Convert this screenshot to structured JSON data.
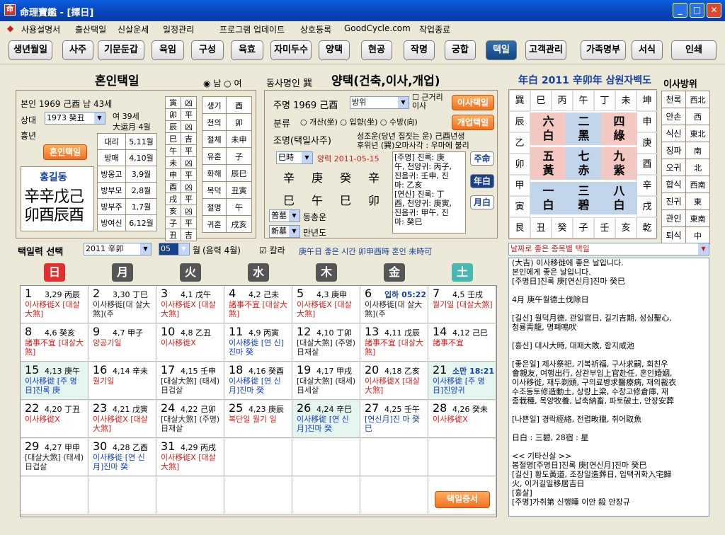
{
  "window": {
    "title": "命理寶鑑 - [擇日]"
  },
  "menu": [
    "사용설명서",
    "출산택일",
    "신살운세",
    "일정관리",
    "프로그램 업데이트",
    "상호등록",
    "GoodCycle.com",
    "작업종료"
  ],
  "toolbar": [
    "생년월일",
    "사주",
    "기문둔갑",
    "육임",
    "구성",
    "육효",
    "자미두수",
    "양택",
    "현공",
    "작명",
    "궁합",
    "택일",
    "고객관리",
    "가족명부",
    "서식",
    "인쇄"
  ],
  "toolbar_active": "택일",
  "marriage": {
    "title": "혼인택일",
    "gender_male": "남",
    "gender_female": "여",
    "self_label": "본인",
    "self_info": "1969 己酉 남 43세",
    "partner_label": "상대",
    "partner_year": "1973 癸丑",
    "partner_info1": "여 39세",
    "partner_info2": "大运月 4월",
    "heunnyeon": "흉년",
    "btn": "혼인택일",
    "name": "홍길동",
    "saju_top": "辛辛戊己",
    "saju_bottom": "卯酉辰酉",
    "dae_rows": [
      [
        "대리",
        "5,11월"
      ],
      [
        "방매",
        "4,10월"
      ],
      [
        "방옹고",
        "3,9월"
      ],
      [
        "방부모",
        "2,8월"
      ],
      [
        "방부주",
        "1,7월"
      ],
      [
        "방여신",
        "6,12월"
      ]
    ],
    "branch_rows": [
      [
        "寅",
        "凶"
      ],
      [
        "卯",
        "平"
      ],
      [
        "辰",
        "凶"
      ],
      [
        "巳",
        "吉"
      ],
      [
        "午",
        "平"
      ],
      [
        "未",
        "凶"
      ],
      [
        "申",
        "平"
      ],
      [
        "酉",
        "凶"
      ],
      [
        "戌",
        "平"
      ],
      [
        "亥",
        "凶"
      ],
      [
        "子",
        "平"
      ],
      [
        "丑",
        "吉"
      ]
    ],
    "god_rows": [
      [
        "생기",
        "酉"
      ],
      [
        "천의",
        "卯"
      ],
      [
        "절체",
        "未申"
      ],
      [
        "유혼",
        "子"
      ],
      [
        "화해",
        "辰巳"
      ],
      [
        "복덕",
        "丑寅"
      ],
      [
        "절명",
        "午"
      ],
      [
        "귀혼",
        "戌亥"
      ]
    ]
  },
  "yangtaek": {
    "top_label": "동사명인",
    "top_dir": "巽",
    "title": "양택(건축,이사,개업)",
    "owner_label": "주명",
    "owner_info": "1969 己酉",
    "dir_select": "방위",
    "check_label": "근거리 이사",
    "btn_move": "이사택일",
    "btn_open": "개업택일",
    "cat_label": "분류",
    "opts": [
      "개산(坐)",
      "입향(坐)",
      "수방(向)"
    ],
    "zm_label": "조명(택일사주)",
    "zm_note1": "성조운(당년 집짓는 운) 己酉년생",
    "zm_note2": "후위년 (巽)오마사각 : 우마에 불리",
    "hour_select": "巳時",
    "solar_date": "양력 2011-05-15",
    "saju_top": [
      "辛",
      "庚",
      "癸",
      "辛"
    ],
    "saju_bottom": [
      "巳",
      "午",
      "巳",
      "卯"
    ],
    "info_text": [
      "[주명] 진록: 庚",
      "午, 천양귀: 丙子,",
      "진음귀: 壬申, 진",
      "마: 乙亥",
      "[연신] 진록: 丁",
      "酉, 천양귀: 庚寅,",
      "진음귀: 甲午, 진",
      "마: 癸巳"
    ],
    "btn_ju": "주命",
    "btn_year": "年白",
    "btn_month": "月白",
    "sel1": "普墓",
    "sel1_label": "동총운",
    "sel2": "新墓",
    "sel2_label": "만년도"
  },
  "samwon": {
    "title": "年白 2011 辛卯年 삼원자백도",
    "top_row": [
      "巽",
      "巳",
      "丙",
      "午",
      "丁",
      "未",
      "坤"
    ],
    "left_col": [
      "辰",
      "乙",
      "卯",
      "甲",
      "寅"
    ],
    "right_col": [
      "申",
      "庚",
      "酉",
      "辛",
      "戌"
    ],
    "bottom_row": [
      "艮",
      "丑",
      "癸",
      "子",
      "壬",
      "亥",
      "乾"
    ],
    "stars": [
      [
        "六",
        "白"
      ],
      [
        "二",
        "黑"
      ],
      [
        "四",
        "綠"
      ],
      [
        "五",
        "黃"
      ],
      [
        "七",
        "赤"
      ],
      [
        "九",
        "紫"
      ],
      [
        "一",
        "白"
      ],
      [
        "三",
        "碧"
      ],
      [
        "八",
        "白"
      ]
    ],
    "colors": {
      "red": "#f4c8c0",
      "blue": "#c0d4ec"
    }
  },
  "move_dir": {
    "title": "이사방위",
    "rows": [
      [
        "천록",
        "西北"
      ],
      [
        "안손",
        "西"
      ],
      [
        "식신",
        "東北"
      ],
      [
        "징파",
        "南"
      ],
      [
        "오귀",
        "北"
      ],
      [
        "합식",
        "西南"
      ],
      [
        "진귀",
        "東"
      ],
      [
        "관인",
        "東南"
      ],
      [
        "퇴식",
        "中"
      ]
    ]
  },
  "calendar": {
    "sel_label": "택일력 선택",
    "year": "2011 辛卯",
    "month": "05",
    "month_unit": "월",
    "lunar": "(음력 4월)",
    "check": "칼라",
    "hint": "庚午日 좋은 시간 卯申酉時 혼인 未時可",
    "dow": [
      "日",
      "月",
      "火",
      "水",
      "木",
      "金",
      "土"
    ],
    "days": [
      {
        "d": "1",
        "l": "3,29 丙辰",
        "t": "이사移徙X [대살大煞]",
        "c": "r"
      },
      {
        "d": "2",
        "l": "3,30 丁巳",
        "t": "이사移徙[대 살大煞](주",
        "c": "k"
      },
      {
        "d": "3",
        "l": "4,1 戊午",
        "t": "이사移徙X [대살大煞]",
        "c": "r"
      },
      {
        "d": "4",
        "l": "4,2 己未",
        "t": "諸事不宜 [대살大煞]",
        "c": "r"
      },
      {
        "d": "5",
        "l": "4,3 庚申",
        "t": "이사移徙X [대살大煞]",
        "c": "r"
      },
      {
        "d": "6",
        "l": "입하 05:22",
        "t": "이사移徙[대 살大煞](주",
        "c": "k"
      },
      {
        "d": "7",
        "l": "4,5 壬戌",
        "t": "월기일 [대살大煞]",
        "c": "r"
      },
      {
        "d": "8",
        "l": "4,6 癸亥",
        "t": "諸事不宜 [대살大煞]",
        "c": "r"
      },
      {
        "d": "9",
        "l": "4,7 甲子",
        "t": "양공기일",
        "c": "r"
      },
      {
        "d": "10",
        "l": "4,8 乙丑",
        "t": "이사移徙X",
        "c": "r"
      },
      {
        "d": "11",
        "l": "4,9 丙寅",
        "t": "이사移徙 [연 신]진마 癸",
        "c": "b"
      },
      {
        "d": "12",
        "l": "4,10 丁卯",
        "t": "[대살大煞] (주명)日재살",
        "c": "k"
      },
      {
        "d": "13",
        "l": "4,11 戊辰",
        "t": "諸事不宜 [대살大煞]",
        "c": "r"
      },
      {
        "d": "14",
        "l": "4,12 己巳",
        "t": "諸事不宜",
        "c": "r"
      },
      {
        "d": "15",
        "l": "4,13 庚午",
        "t": "이사移徙 [주 명日]진록 庚",
        "c": "b",
        "g": 1
      },
      {
        "d": "16",
        "l": "4,14 辛未",
        "t": "월기일",
        "c": "r"
      },
      {
        "d": "17",
        "l": "4,15 壬申",
        "t": "[대살大煞] (태세)日겁살",
        "c": "k"
      },
      {
        "d": "18",
        "l": "4,16 癸酉",
        "t": "이사移徙 [연 신月]진마 癸",
        "c": "b"
      },
      {
        "d": "19",
        "l": "4,17 甲戌",
        "t": "[대살大煞] (태세)日세살",
        "c": "k"
      },
      {
        "d": "20",
        "l": "4,18 乙亥",
        "t": "이사移徙X [대살大煞]",
        "c": "r"
      },
      {
        "d": "21",
        "l": "소만 18:21",
        "t": "이사移徙 [주 명日]진양귀",
        "c": "b",
        "g": 1
      },
      {
        "d": "22",
        "l": "4,20 丁丑",
        "t": "이사移徙X",
        "c": "r"
      },
      {
        "d": "23",
        "l": "4,21 戊寅",
        "t": "이사移徙X [대살大煞]",
        "c": "r"
      },
      {
        "d": "24",
        "l": "4,22 己卯",
        "t": "[대살大煞] (주명)日재살",
        "c": "k"
      },
      {
        "d": "25",
        "l": "4,23 庚辰",
        "t": "복단일 월기 일",
        "c": "r"
      },
      {
        "d": "26",
        "l": "4,24 辛巳",
        "t": "이사移徙 [연 신月]진마 癸",
        "c": "b",
        "g": 1
      },
      {
        "d": "27",
        "l": "4,25 壬午",
        "t": "[연신月]진 마 癸巳",
        "c": "b"
      },
      {
        "d": "28",
        "l": "4,26 癸未",
        "t": "이사移徙X",
        "c": "r"
      },
      {
        "d": "29",
        "l": "4,27 甲申",
        "t": "[대살大煞] (태세)日겁살",
        "c": "k"
      },
      {
        "d": "30",
        "l": "4,28 乙酉",
        "t": "이사移徙 [연 신月]진마 癸",
        "c": "b"
      },
      {
        "d": "31",
        "l": "4,29 丙戌",
        "t": "이사移徙X [대살大煞]",
        "c": "r"
      }
    ],
    "btn_cert": "택일증서"
  },
  "purpose": {
    "select": "날짜로 좋은 종목별 택일",
    "text": [
      "(大吉) 이사移徙에 좋은 날입니다.",
      "본인에게 좋은 날입니다.",
      "[주명日]진록 庚[연신月]진마 癸巳",
      "",
      "4月 庚午월德土伐除日",
      "",
      "[길신] 월덕月德, 관일官日, 길기吉期, 성심聖心,",
      "청룡靑龍, 명폐鳴吠",
      "",
      "[흉신] 대시大時, 대패大敗, 함지咸池",
      "",
      "[좋은일] 제사祭祀, 기복祈福, 구사求嗣, 회친우",
      "會親友, 여행出行, 상관부임上官赴任, 혼인婚姻,",
      "이사移徙, 재두剃頭, 구의료병求醫療病, 재의裁衣",
      "수조동토修造動土, 상량上梁, 수창고修倉庫, 재",
      "종栽種, 목양牧養, 납축納畜, 파토破土, 안장安葬",
      "",
      "[나쁜일] 경락經絡, 전렵畋獵, 취어取魚",
      "",
      "日白 : 三碧, 28宿 : 星",
      "",
      "<< 기타신살 >>",
      "봉절명[주명日]진록 庚[연신月]진마 癸巳",
      "[길신] 황도黃道, 조장일造葬日, 입택귀화入宅歸",
      "火, 이거길일移居吉日",
      "[흉살]",
      "[주명]가취第 신행睡 이안 殺 안장규"
    ]
  }
}
